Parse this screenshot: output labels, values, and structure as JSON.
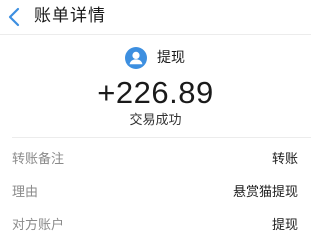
{
  "header": {
    "title": "账单详情",
    "back_icon": "chevron-left-icon"
  },
  "summary": {
    "avatar_icon": "user-avatar-icon",
    "counterpart": "提现",
    "amount": "+226.89",
    "status": "交易成功"
  },
  "details": [
    {
      "label": "转账备注",
      "value": "转账"
    },
    {
      "label": "理由",
      "value": "悬赏猫提现"
    },
    {
      "label": "对方账户",
      "value": "提现"
    }
  ],
  "colors": {
    "accent": "#3d8fe0",
    "label": "#8a8a8a",
    "text": "#1a1a1a"
  }
}
